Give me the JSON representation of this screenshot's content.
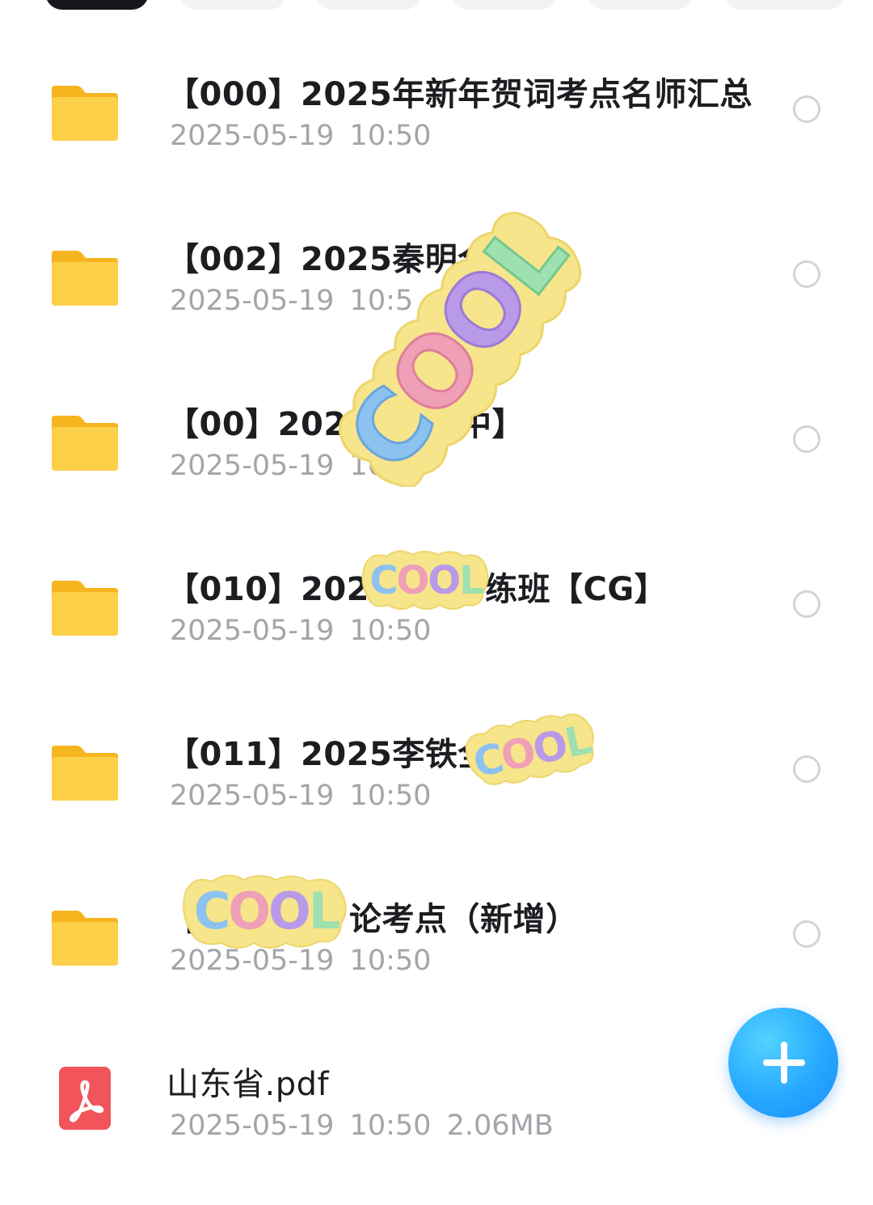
{
  "colors": {
    "folder": "#fcc93a",
    "pdf": "#f2545b",
    "fab": "#27a8ff",
    "title_text": "#1c1d21",
    "meta_text": "#a3a5ab"
  },
  "tabs": [
    {
      "name": "tab-1",
      "active": true
    },
    {
      "name": "tab-2",
      "active": false
    },
    {
      "name": "tab-3",
      "active": false
    },
    {
      "name": "tab-4",
      "active": false
    },
    {
      "name": "tab-5",
      "active": false
    },
    {
      "name": "tab-6",
      "active": false
    }
  ],
  "files": [
    {
      "title": "【000】2025年新年贺词考点名师汇总",
      "date": "2025-05-19",
      "time": "10:50",
      "icon": "folder-icon"
    },
    {
      "title": "【002】2025秦明全",
      "date": "2025-05-19",
      "time": "10:5",
      "icon": "folder-icon"
    },
    {
      "title": "【00】2025",
      "title_tail": "中】",
      "date": "2025-05-19",
      "time": "10:5",
      "icon": "folder-icon"
    },
    {
      "title": "【010】2025年",
      "title_tail": "练班【CG】",
      "date": "2025-05-19",
      "time": "10:50",
      "icon": "folder-icon"
    },
    {
      "title": "【011】2025李铁全年",
      "date": "2025-05-19",
      "time": "10:50",
      "icon": "folder-icon"
    },
    {
      "title": "【",
      "title_tail": "论考点（新增）",
      "date": "2025-05-19",
      "time": "10:50",
      "icon": "folder-icon"
    },
    {
      "title": "山东省.pdf",
      "date": "2025-05-19",
      "time": "10:50",
      "size": "2.06MB",
      "icon": "pdf-icon"
    }
  ],
  "stickers": {
    "text": "COOL"
  },
  "fab": {
    "icon": "plus-icon"
  }
}
